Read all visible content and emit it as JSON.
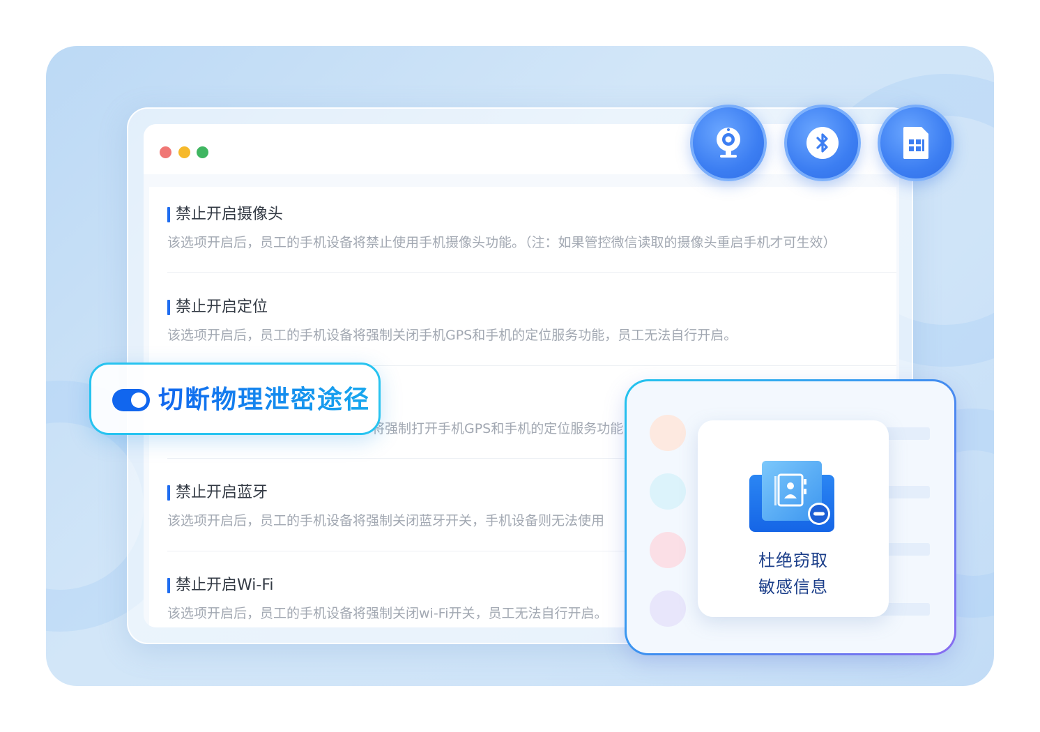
{
  "badge": {
    "label": "切断物理泄密途径"
  },
  "items": [
    {
      "title": "禁止开启摄像头",
      "desc": "该选项开启后，员工的手机设备将禁止使用手机摄像头功能。（注：如果管控微信读取的摄像头重启手机才可生效）"
    },
    {
      "title": "禁止开启定位",
      "desc": "该选项开启后，员工的手机设备将强制关闭手机GPS和手机的定位服务功能，员工无法自行开启。"
    },
    {
      "title": "",
      "desc": "将强制打开手机GPS和手机的定位服务功能"
    },
    {
      "title": "禁止开启蓝牙",
      "desc": "该选项开启后，员工的手机设备将强制关闭蓝牙开关，手机设备则无法使用"
    },
    {
      "title": "禁止开启Wi-Fi",
      "desc": "该选项开启后，员工的手机设备将强制关闭wi-Fi开关，员工无法自行开启。"
    }
  ],
  "icons": [
    "camera-icon",
    "bluetooth-icon",
    "sim-card-icon",
    "contact-book-icon"
  ],
  "card": {
    "line1": "杜绝窃取",
    "line2": "敏感信息"
  },
  "colors": {
    "accent": "#1f6df0",
    "badge_border": "#27c3f0",
    "toggle": "#1166ee",
    "dot_red": "#f07775",
    "dot_yellow": "#f6b92b",
    "dot_green": "#3fb661"
  }
}
